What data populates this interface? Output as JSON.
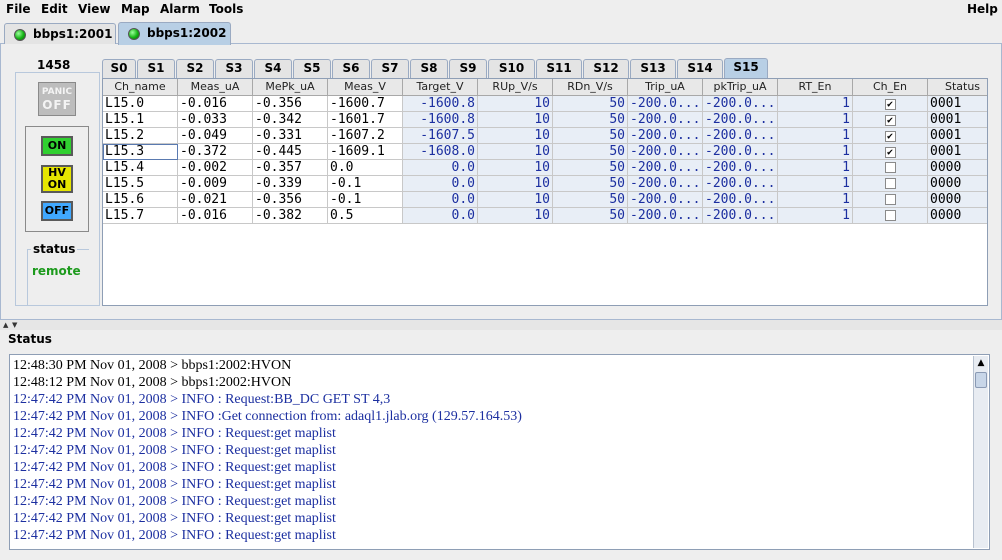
{
  "menu": {
    "file": "File",
    "edit": "Edit",
    "view": "View",
    "map": "Map",
    "alarm": "Alarm",
    "tools": "Tools",
    "help": "Help"
  },
  "connection_tabs": [
    {
      "label": "bbps1:2001",
      "selected": false,
      "status_color": "#13b313"
    },
    {
      "label": "bbps1:2002",
      "selected": true,
      "status_color": "#13b313"
    }
  ],
  "crate": {
    "id": "1458",
    "panic_label_top": "PANIC",
    "panic_label_bottom": "OFF",
    "on_label": "ON",
    "hvon_label_top": "HV",
    "hvon_label_bottom": "ON",
    "off_label": "OFF",
    "status_title": "status",
    "status_value": "remote"
  },
  "slot_tabs": [
    "S0",
    "S1",
    "S2",
    "S3",
    "S4",
    "S5",
    "S6",
    "S7",
    "S8",
    "S9",
    "S10",
    "S11",
    "S12",
    "S13",
    "S14",
    "S15"
  ],
  "selected_slot": "S15",
  "table": {
    "columns": [
      "Ch_name",
      "Meas_uA",
      "MePk_uA",
      "Meas_V",
      "Target_V",
      "RUp_V/s",
      "RDn_V/s",
      "Trip_uA",
      "pkTrip_uA",
      "RT_En",
      "Ch_En",
      "Status"
    ],
    "rows": [
      [
        "L15.0",
        "-0.016",
        "-0.356",
        "-1600.7",
        "-1600.8",
        "10",
        "50",
        "-200.0...",
        "-200.0...",
        "1",
        "checked",
        "0001"
      ],
      [
        "L15.1",
        "-0.033",
        "-0.342",
        "-1601.7",
        "-1600.8",
        "10",
        "50",
        "-200.0...",
        "-200.0...",
        "1",
        "checked",
        "0001"
      ],
      [
        "L15.2",
        "-0.049",
        "-0.331",
        "-1607.2",
        "-1607.5",
        "10",
        "50",
        "-200.0...",
        "-200.0...",
        "1",
        "checked",
        "0001"
      ],
      [
        "L15.3",
        "-0.372",
        "-0.445",
        "-1609.1",
        "-1608.0",
        "10",
        "50",
        "-200.0...",
        "-200.0...",
        "1",
        "checked",
        "0001"
      ],
      [
        "L15.4",
        "-0.002",
        "-0.357",
        "0.0",
        "0.0",
        "10",
        "50",
        "-200.0...",
        "-200.0...",
        "1",
        "unchecked",
        "0000"
      ],
      [
        "L15.5",
        "-0.009",
        "-0.339",
        "-0.1",
        "0.0",
        "10",
        "50",
        "-200.0...",
        "-200.0...",
        "1",
        "unchecked",
        "0000"
      ],
      [
        "L15.6",
        "-0.021",
        "-0.356",
        "-0.1",
        "0.0",
        "10",
        "50",
        "-200.0...",
        "-200.0...",
        "1",
        "unchecked",
        "0000"
      ],
      [
        "L15.7",
        "-0.016",
        "-0.382",
        "0.5",
        "0.0",
        "10",
        "50",
        "-200.0...",
        "-200.0...",
        "1",
        "unchecked",
        "0000"
      ]
    ]
  },
  "status_panel": {
    "title": "Status",
    "log": [
      {
        "text": "12:48:30 PM Nov 01, 2008 > bbps1:2002:HVON",
        "color": "#000000"
      },
      {
        "text": "12:48:12 PM Nov 01, 2008 > bbps1:2002:HVON",
        "color": "#000000"
      },
      {
        "text": "12:47:42 PM Nov 01, 2008 > INFO : Request:BB_DC GET ST 4,3",
        "color": "#1c2fa0"
      },
      {
        "text": "12:47:42 PM Nov 01, 2008 > INFO :Get connection from: adaql1.jlab.org (129.57.164.53)",
        "color": "#1c2fa0"
      },
      {
        "text": "12:47:42 PM Nov 01, 2008 > INFO : Request:get maplist",
        "color": "#1c2fa0"
      },
      {
        "text": "12:47:42 PM Nov 01, 2008 > INFO : Request:get maplist",
        "color": "#1c2fa0"
      },
      {
        "text": "12:47:42 PM Nov 01, 2008 > INFO : Request:get maplist",
        "color": "#1c2fa0"
      },
      {
        "text": "12:47:42 PM Nov 01, 2008 > INFO : Request:get maplist",
        "color": "#1c2fa0"
      },
      {
        "text": "12:47:42 PM Nov 01, 2008 > INFO : Request:get maplist",
        "color": "#1c2fa0"
      },
      {
        "text": "12:47:42 PM Nov 01, 2008 > INFO : Request:get maplist",
        "color": "#1c2fa0"
      },
      {
        "text": "12:47:42 PM Nov 01, 2008 > INFO : Request:get maplist",
        "color": "#1c2fa0"
      }
    ]
  },
  "icons": {
    "led": "green-led-icon",
    "scroll_left": "arrow-left-icon",
    "scroll_right": "arrow-right-icon",
    "scroll_up": "arrow-up-icon",
    "checkbox": "checkbox-icon"
  }
}
